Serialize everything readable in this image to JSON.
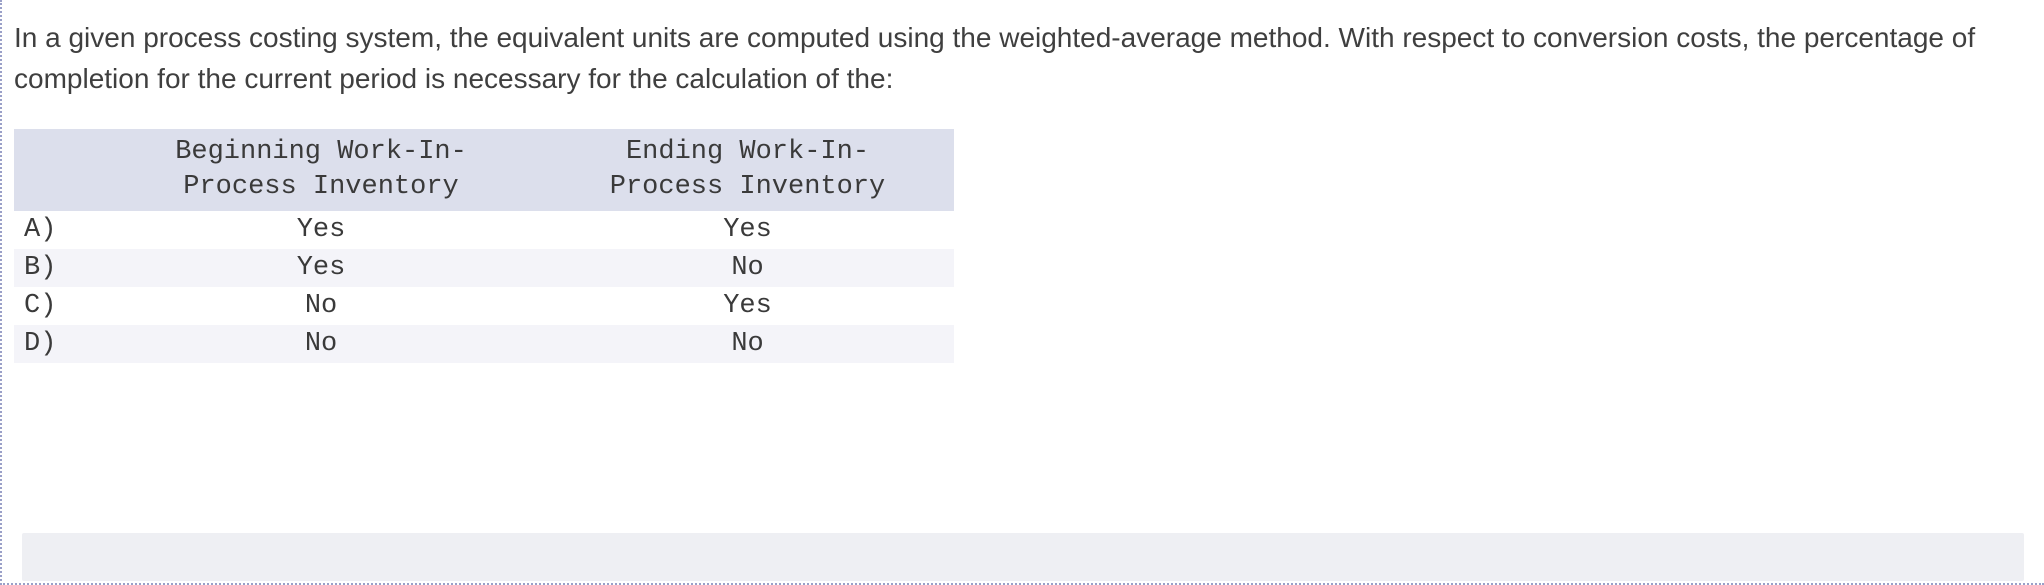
{
  "question": "In a given process costing system, the equivalent units are computed using the weighted-average method. With respect to conversion costs, the percentage of completion for the current period is necessary for the calculation of the:",
  "table": {
    "headers": {
      "blank": "",
      "col1": "Beginning Work-In-\nProcess Inventory",
      "col2": "Ending Work-In-\nProcess Inventory"
    },
    "rows": [
      {
        "label": "A)",
        "col1": "Yes",
        "col2": "Yes"
      },
      {
        "label": "B)",
        "col1": "Yes",
        "col2": "No"
      },
      {
        "label": "C)",
        "col1": "No",
        "col2": "Yes"
      },
      {
        "label": "D)",
        "col1": "No",
        "col2": "No"
      }
    ]
  }
}
